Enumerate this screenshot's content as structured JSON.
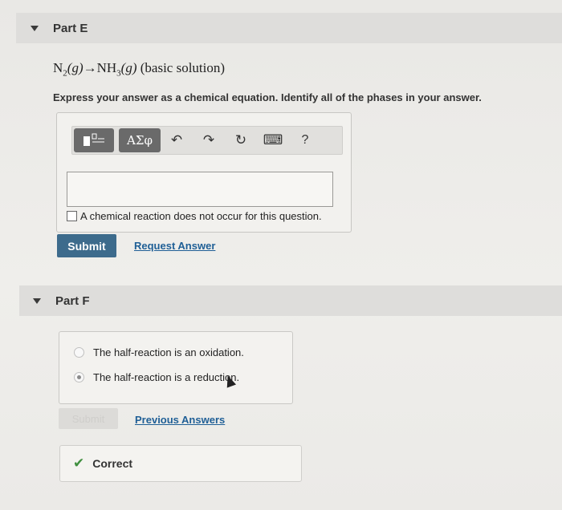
{
  "partE": {
    "title": "Part E",
    "equation": {
      "n": "N",
      "n_sub": "2",
      "g1": "(g)",
      "arrow": "→",
      "nh": "NH",
      "nh_sub": "3",
      "g2": "(g)",
      "note": " (basic solution)"
    },
    "instruction": "Express your answer as a chemical equation. Identify all of the phases in your answer.",
    "toolbar": {
      "greek_label": "ΑΣφ",
      "undo_icon": "↶",
      "redo_icon": "↷",
      "reset_icon": "↻",
      "keyboard_icon": "⌨",
      "help_label": "?"
    },
    "answer_value": "",
    "no_reaction_label": "A chemical reaction does not occur for this question.",
    "submit_label": "Submit",
    "request_answer_label": "Request Answer"
  },
  "partF": {
    "title": "Part F",
    "options": [
      {
        "label": "The half-reaction is an oxidation.",
        "selected": false
      },
      {
        "label": "The half-reaction is a reduction.",
        "selected": true
      }
    ],
    "submit_label": "Submit",
    "previous_answers_label": "Previous Answers",
    "feedback": "Correct"
  }
}
